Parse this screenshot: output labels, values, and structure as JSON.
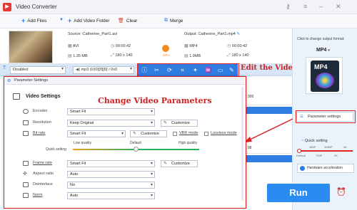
{
  "window": {
    "title": "Video Converter"
  },
  "toolbar": {
    "add_files": "Add Files",
    "add_video_folder": "Add Video Folder",
    "clear": "Clear",
    "merge": "Merge"
  },
  "file": {
    "source_name": "Source: Catherine_Part1.avi",
    "output_name": "Output: Catherine_Part1.mp4",
    "src_format": "AVI",
    "src_duration": "00:00:42",
    "src_size": "1.35 MB",
    "src_resolution": "180 x 140",
    "out_format": "MP4",
    "out_duration": "00:00:42",
    "out_size": "1.9MB",
    "out_resolution": "180 x 140",
    "gpu_label": "GPU"
  },
  "options": {
    "subtitle": "Disabled",
    "audio": "mp3 (U(0)[0][0] / 0x0"
  },
  "annotations": {
    "edit_video": "Edit the Video",
    "change_params": "Change Video Parameters"
  },
  "background_peek": {
    "value_a": "x 300",
    "value_b": "x 98"
  },
  "dialog": {
    "title": "Parameter Settings",
    "section": "Video Settings",
    "encoder_label": "Encoder",
    "encoder_value": "Smart Fit",
    "resolution_label": "Resolution",
    "resolution_value": "Keep Original",
    "customize": "Customize",
    "bitrate_label": "Bit rate",
    "bitrate_value": "Smart Fit",
    "vbr_mode": "VBR mode",
    "lossless_mode": "Lossless mode",
    "low_quality": "Low quality",
    "default_quality": "Default",
    "high_quality": "High quality",
    "quick_setting": "Quick setting",
    "framerate_label": "Frame rate",
    "framerate_value": "Smart Fit",
    "aspect_label": "Aspect ratio",
    "aspect_value": "Auto",
    "deinterlace_label": "Deinterlace",
    "deinterlace_value": "No",
    "norm_label": "Norm",
    "norm_value": "Auto"
  },
  "right_panel": {
    "change_format": "Click to change output format:",
    "format": "MP4",
    "param_settings": "Parameter settings",
    "quick_setting": "Quick setting",
    "q_480p": "480P",
    "q_1080p": "1080P",
    "q_4k": "4K",
    "q_default": "Default",
    "q_720p": "720P",
    "q_2k": "2K",
    "hw_accel": "Hardware acceleration"
  },
  "run_label": "Run",
  "colors": {
    "accent": "#2f7de1",
    "annotation": "#e02020",
    "run": "#2a8cf0"
  }
}
